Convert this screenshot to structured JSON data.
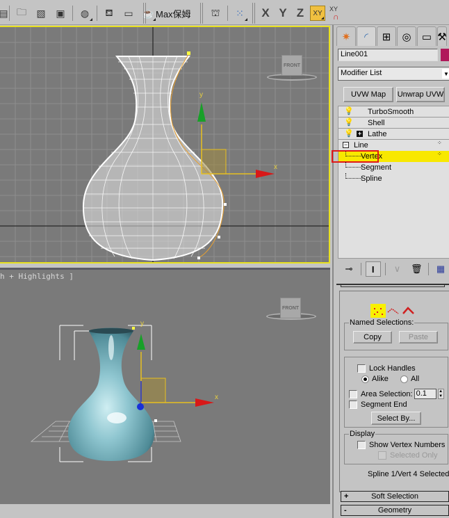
{
  "toolbar": {
    "left_icons": [
      "render-frame-icon",
      "open-file-icon",
      "curve-editor-icon",
      "schematic-view-icon",
      "material-editor-icon",
      "render-setup-icon",
      "rendered-frame-window-icon",
      "render-teapot-icon"
    ],
    "plugin_label": "Max保姆",
    "right_icons": [
      "particle-flow-icon",
      "snaps-icon"
    ],
    "axis_x": "X",
    "axis_y": "Y",
    "axis_z": "Z",
    "axis_xy": "XY",
    "axis_xy_snap": "XY",
    "accent_color": "#f0c040"
  },
  "viewports": {
    "front": {
      "cube_label": "FRONT",
      "gizmo_x": "x",
      "gizmo_y": "y",
      "active_border_color": "#e8e020"
    },
    "perspective": {
      "label": "h + Highlights ]",
      "cube_label": "FRONT",
      "gizmo_x": "x",
      "gizmo_y": "y"
    }
  },
  "command_panel": {
    "tabs": [
      "create-icon",
      "modify-icon",
      "hierarchy-icon",
      "motion-icon",
      "display-icon",
      "utilities-icon"
    ],
    "object_name": "Line001",
    "object_color": "#b0185a",
    "modifier_list": "Modifier List",
    "buttons": {
      "uvw_map": "UVW Map",
      "unwrap_uvw": "Unwrap UVW"
    },
    "stack": [
      {
        "label": "TurboSmooth",
        "type": "modifier"
      },
      {
        "label": "Shell",
        "type": "modifier"
      },
      {
        "label": "Lathe",
        "type": "modifier-expandable"
      },
      {
        "label": "Line",
        "type": "base"
      },
      {
        "label": "Vertex",
        "type": "sub",
        "selected": true
      },
      {
        "label": "Segment",
        "type": "sub"
      },
      {
        "label": "Spline",
        "type": "sub"
      }
    ],
    "stack_tools": [
      "pin-stack-icon",
      "show-end-result-icon",
      "make-unique-icon",
      "remove-modifier-icon",
      "configure-modifier-sets-icon"
    ],
    "selection": {
      "levels": [
        "vertex-level-icon",
        "segment-level-icon",
        "spline-level-icon"
      ],
      "named_selections_title": "Named Selections:",
      "copy_label": "Copy",
      "paste_label": "Paste",
      "lock_handles": "Lock Handles",
      "alike": "Alike",
      "all": "All",
      "area_selection": "Area Selection:",
      "area_value": "0.1",
      "segment_end": "Segment End",
      "select_by": "Select By...",
      "display_title": "Display",
      "show_vertex_numbers": "Show Vertex Numbers",
      "selected_only": "Selected Only",
      "status": "Spline 1/Vert 4 Selected"
    },
    "rollouts": [
      {
        "sign": "+",
        "label": "Soft Selection"
      },
      {
        "sign": "-",
        "label": "Geometry"
      }
    ]
  }
}
